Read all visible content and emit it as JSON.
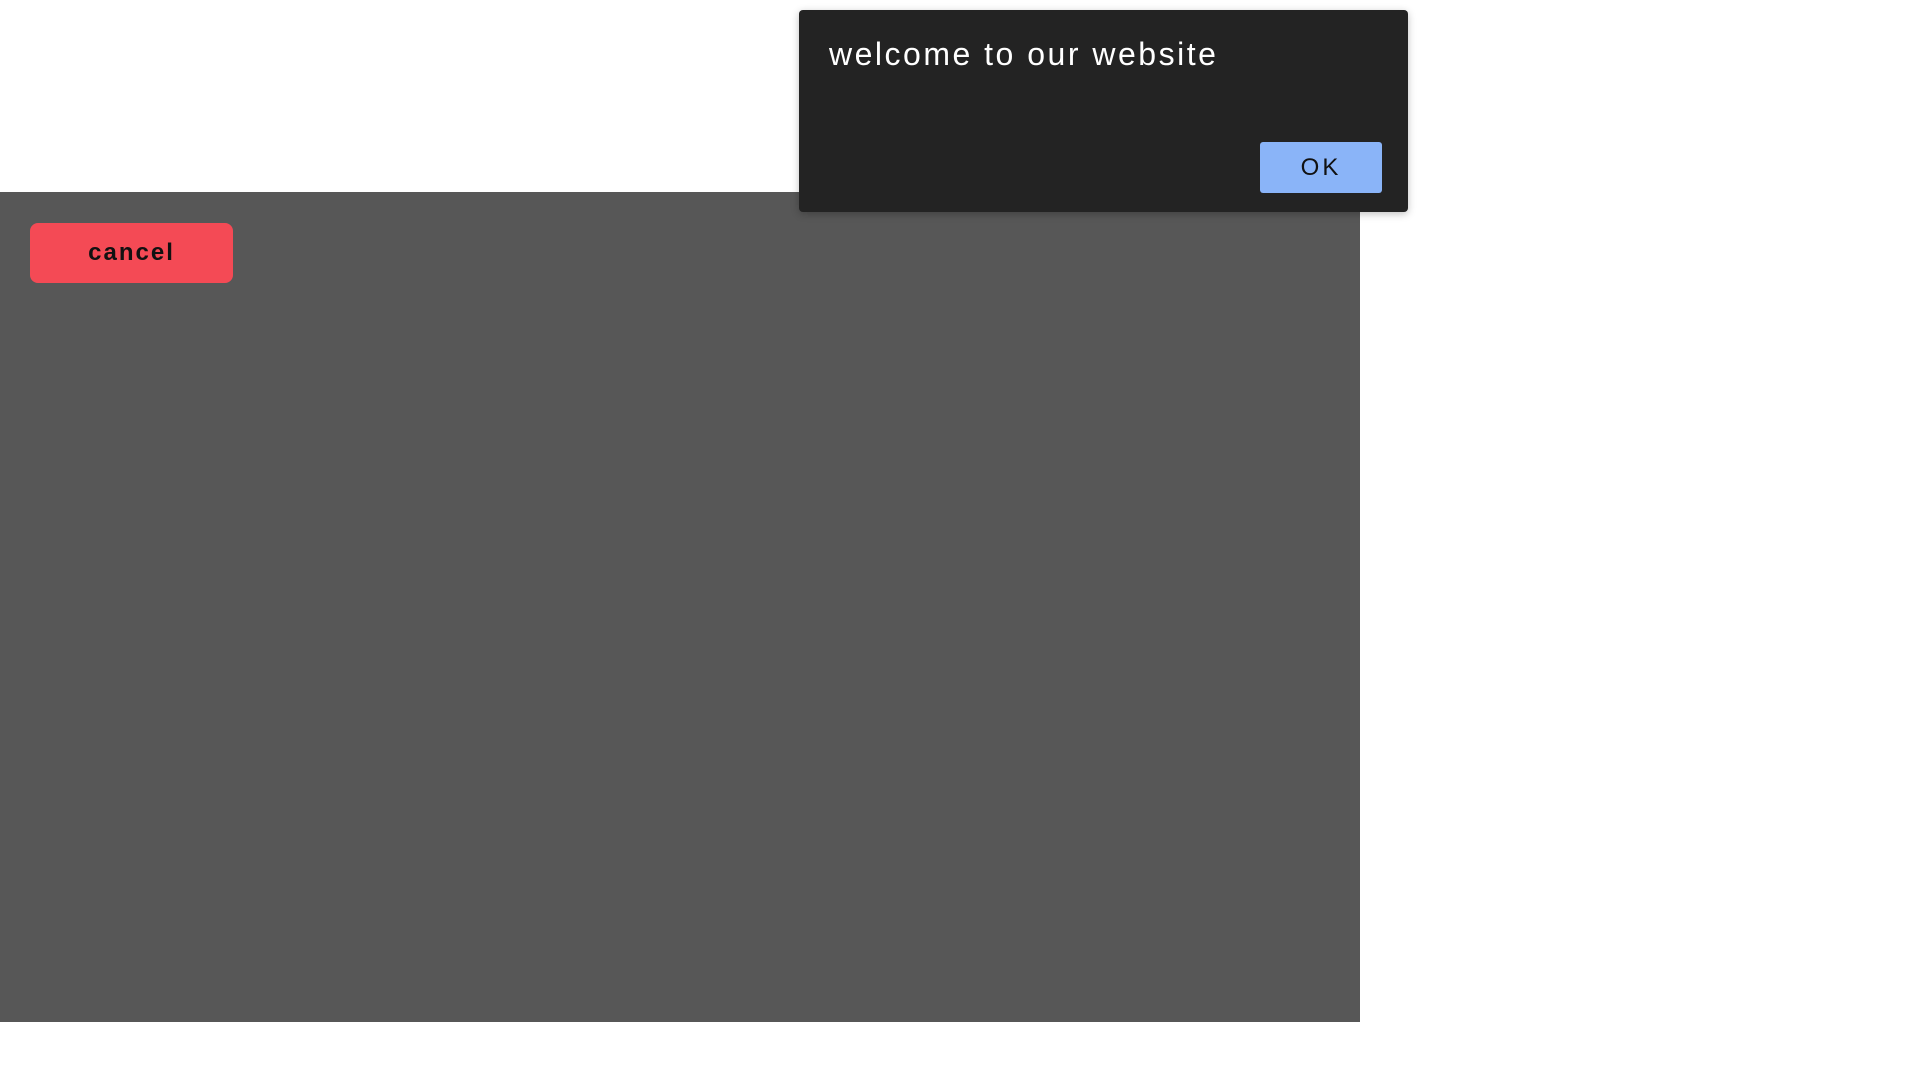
{
  "overlay": {
    "cancel_label": "cancel",
    "background_color": "#575757",
    "cancel_color": "#f44a55"
  },
  "dialog": {
    "message": "welcome to our website",
    "ok_label": "OK",
    "background_color": "#232323",
    "ok_color": "#8ab4f8"
  }
}
